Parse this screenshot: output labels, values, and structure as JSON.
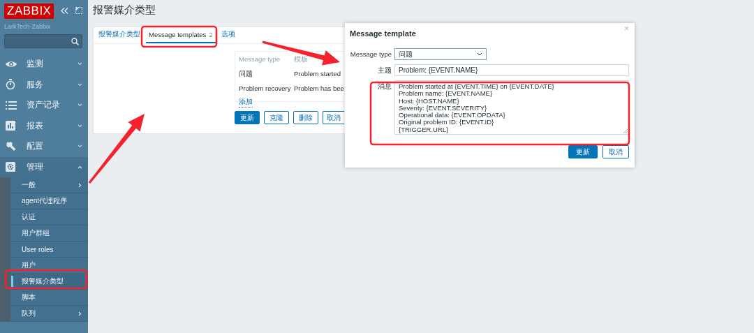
{
  "sidebar": {
    "logo": "ZABBIX",
    "server_name": "LarkTech-Zabbix",
    "menu": [
      {
        "label": "监测",
        "expanded": false
      },
      {
        "label": "服务",
        "expanded": false
      },
      {
        "label": "资产记录",
        "expanded": false
      },
      {
        "label": "报表",
        "expanded": false
      },
      {
        "label": "配置",
        "expanded": false
      },
      {
        "label": "管理",
        "expanded": true,
        "children": [
          {
            "label": "一般",
            "selected": false,
            "has_submenu": true
          },
          {
            "label": "agent代理程序",
            "selected": false,
            "has_submenu": false
          },
          {
            "label": "认证",
            "selected": false,
            "has_submenu": false
          },
          {
            "label": "用户群组",
            "selected": false,
            "has_submenu": false
          },
          {
            "label": "User roles",
            "selected": false,
            "has_submenu": false
          },
          {
            "label": "用户",
            "selected": false,
            "has_submenu": false
          },
          {
            "label": "报警媒介类型",
            "selected": true,
            "has_submenu": false
          },
          {
            "label": "脚本",
            "selected": false,
            "has_submenu": false
          },
          {
            "label": "队列",
            "selected": false,
            "has_submenu": true
          }
        ]
      }
    ]
  },
  "page_title": "报警媒介类型",
  "tabs": [
    {
      "label": "报警媒介类型",
      "selected": false
    },
    {
      "label": "Message templates",
      "count": "2",
      "selected": true
    },
    {
      "label": "选项",
      "selected": false
    }
  ],
  "templates_table": {
    "columns": [
      "Message type",
      "模板"
    ],
    "rows": [
      [
        "问题",
        "Problem started"
      ],
      [
        "Problem recovery",
        "Problem has bee"
      ]
    ],
    "add_link": "添加"
  },
  "buttons": [
    {
      "label": "更新",
      "primary": true
    },
    {
      "label": "克隆",
      "primary": false
    },
    {
      "label": "删除",
      "primary": false
    },
    {
      "label": "取消",
      "primary": false
    }
  ],
  "dialog": {
    "title": "Message template",
    "close": "×",
    "fields": [
      {
        "kind": "select",
        "label": "Message type",
        "value": "问题"
      },
      {
        "kind": "input",
        "label": "主题",
        "value": "Problem: {EVENT.NAME}"
      },
      {
        "kind": "textarea",
        "label": "消息",
        "value": "Problem started at {EVENT.TIME} on {EVENT.DATE}\nProblem name: {EVENT.NAME}\nHost: {HOST.NAME}\nSeverity: {EVENT.SEVERITY}\nOperational data: {EVENT.OPDATA}\nOriginal problem ID: {EVENT.ID}\n{TRIGGER.URL}"
      }
    ],
    "buttons": [
      {
        "label": "更新",
        "primary": true
      },
      {
        "label": "取消",
        "primary": false
      }
    ]
  }
}
